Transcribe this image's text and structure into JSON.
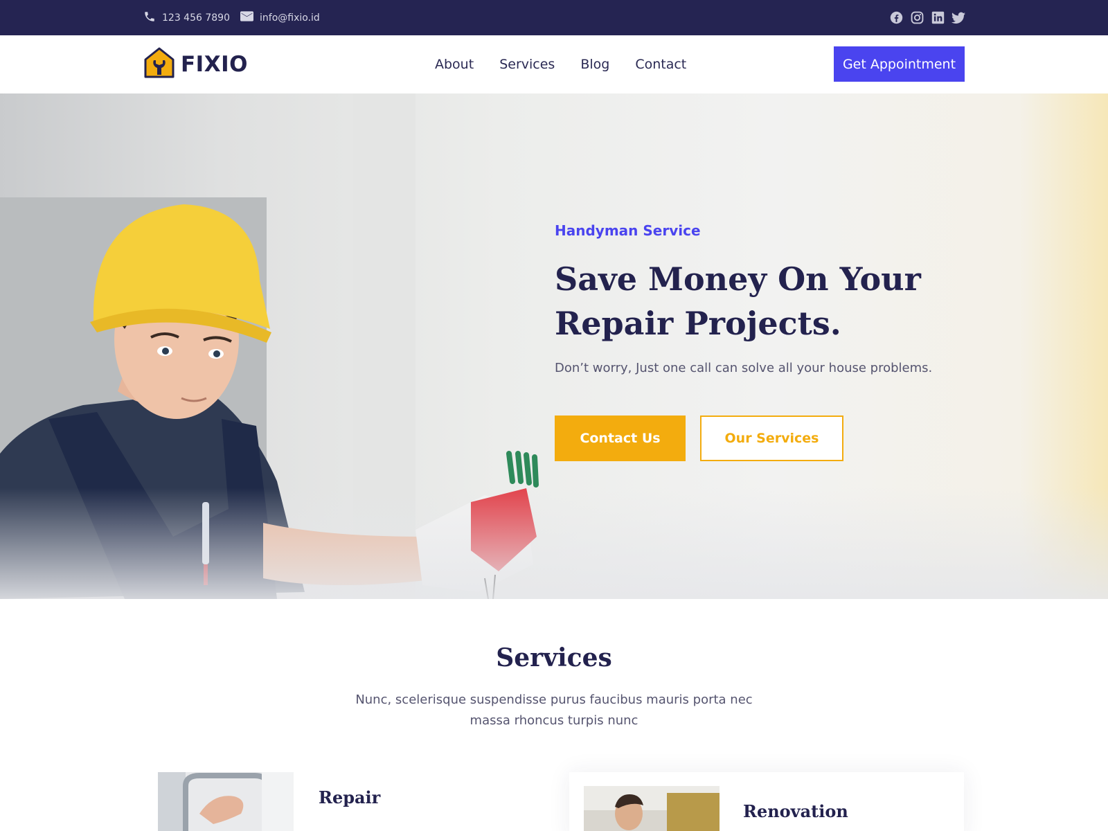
{
  "topbar": {
    "phone": "123 456 7890",
    "email": "info@fixio.id",
    "socials": [
      "facebook-icon",
      "instagram-icon",
      "linkedin-icon",
      "twitter-icon"
    ]
  },
  "brand": {
    "name": "FIXIO",
    "accent": "#f3ac0e",
    "primary": "#4a44ef",
    "dark": "#252452"
  },
  "nav": {
    "items": [
      {
        "label": "About"
      },
      {
        "label": "Services"
      },
      {
        "label": "Blog"
      },
      {
        "label": "Contact"
      }
    ],
    "cta_label": "Get Appointment"
  },
  "hero": {
    "eyebrow": "Handyman Service",
    "headline_line1": "Save Money On Your",
    "headline_line2": "Repair Projects.",
    "subtext": "Don’t worry, Just one call can solve all your house problems.",
    "primary_button": "Contact Us",
    "secondary_button": "Our Services"
  },
  "services": {
    "title": "Services",
    "description_line1": "Nunc, scelerisque suspendisse purus faucibus mauris porta nec",
    "description_line2": "massa rhoncus turpis nunc",
    "cards": [
      {
        "title": "Repair"
      },
      {
        "title": "Renovation"
      }
    ]
  }
}
